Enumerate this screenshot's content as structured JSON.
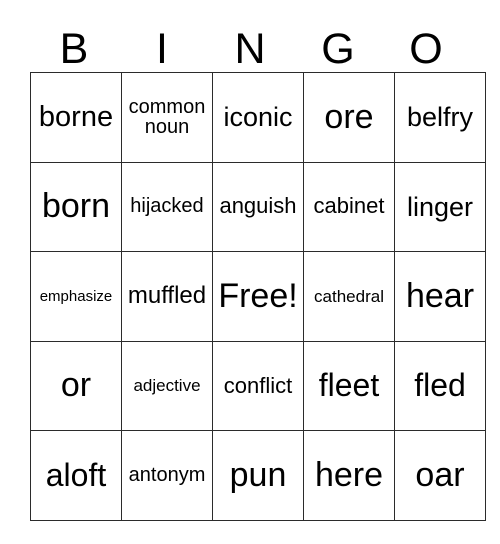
{
  "card": {
    "header": {
      "letters": [
        "B",
        "I",
        "N",
        "G",
        "O"
      ]
    },
    "grid": {
      "columns": 5,
      "rows": 5,
      "cells": [
        {
          "text": "borne",
          "size": "fs-l"
        },
        {
          "text": "common noun",
          "size": "fs-s"
        },
        {
          "text": "iconic",
          "size": "fs-ml"
        },
        {
          "text": "ore",
          "size": "fs-xxl"
        },
        {
          "text": "belfry",
          "size": "fs-ml"
        },
        {
          "text": "born",
          "size": "fs-xxl"
        },
        {
          "text": "hijacked",
          "size": "fs-s"
        },
        {
          "text": "anguish",
          "size": "fs-ms"
        },
        {
          "text": "cabinet",
          "size": "fs-ms"
        },
        {
          "text": "linger",
          "size": "fs-ml"
        },
        {
          "text": "emphasize",
          "size": "fs-xxs"
        },
        {
          "text": "muffled",
          "size": "fs-m"
        },
        {
          "text": "Free!",
          "size": "fs-xxl"
        },
        {
          "text": "cathedral",
          "size": "fs-xs"
        },
        {
          "text": "hear",
          "size": "fs-xxl"
        },
        {
          "text": "or",
          "size": "fs-xxl"
        },
        {
          "text": "adjective",
          "size": "fs-xs"
        },
        {
          "text": "conflict",
          "size": "fs-ms"
        },
        {
          "text": "fleet",
          "size": "fs-xl"
        },
        {
          "text": "fled",
          "size": "fs-xl"
        },
        {
          "text": "aloft",
          "size": "fs-xl"
        },
        {
          "text": "antonym",
          "size": "fs-s"
        },
        {
          "text": "pun",
          "size": "fs-xxl"
        },
        {
          "text": "here",
          "size": "fs-xxl"
        },
        {
          "text": "oar",
          "size": "fs-xxl"
        }
      ]
    }
  },
  "colors": {
    "background": "#ffffff",
    "text": "#000000",
    "grid_line": "#2b2b2b"
  }
}
